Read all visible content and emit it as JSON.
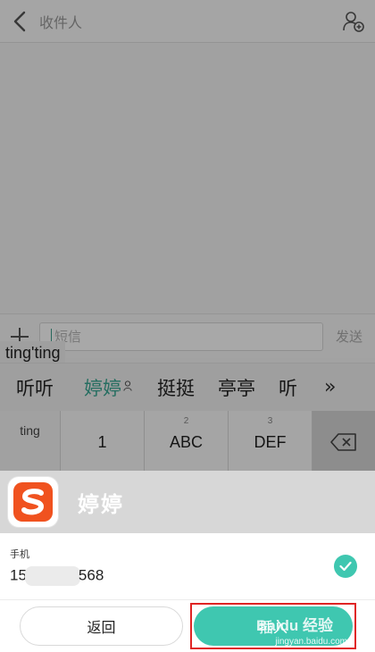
{
  "topbar": {
    "recipient_placeholder": "收件人"
  },
  "compose": {
    "placeholder": "短信",
    "send_label": "发送"
  },
  "ime": {
    "pinyin": "ting'ting",
    "candidates": [
      "听听",
      "婷婷",
      "挺挺",
      "亭亭",
      "听"
    ],
    "selected_index": 1,
    "more": "»",
    "keys": {
      "left_column": "ting",
      "row": [
        {
          "num": "",
          "label": "1"
        },
        {
          "num": "2",
          "label": "ABC"
        },
        {
          "num": "3",
          "label": "DEF"
        }
      ]
    }
  },
  "sheet": {
    "contact_name": "婷婷",
    "phone_label": "手机",
    "phone_prefix": "15",
    "phone_suffix": "568",
    "back_label": "返回",
    "insert_label": "插入",
    "watermark_logo": "Baidu 经验",
    "watermark_url": "jingyan.baidu.com"
  },
  "colors": {
    "accent": "#3fc7b0",
    "highlight_box": "#e02424",
    "sogou_orange": "#f0521f"
  }
}
